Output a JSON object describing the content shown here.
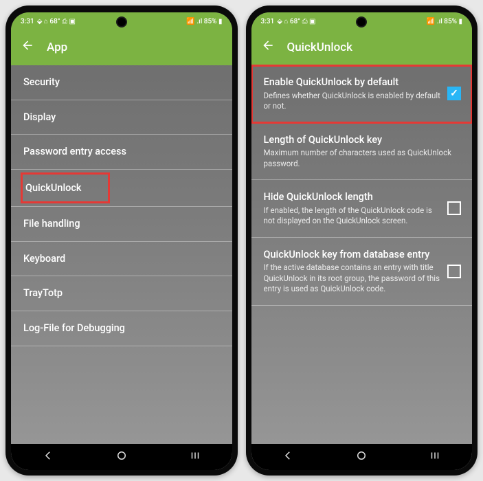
{
  "status": {
    "time": "3:31",
    "indicators": "⬙ ⌂ 68° ⎙ ▣",
    "right": "📶 .ıl 85% ▮"
  },
  "phoneA": {
    "title": "App",
    "items": [
      "Security",
      "Display",
      "Password entry access",
      "QuickUnlock",
      "File handling",
      "Keyboard",
      "TrayTotp",
      "Log-File for Debugging"
    ]
  },
  "phoneB": {
    "title": "QuickUnlock",
    "rows": [
      {
        "title": "Enable QuickUnlock by default",
        "sub": "Defines whether QuickUnlock is enabled by default or not.",
        "checked": true,
        "highlight": true
      },
      {
        "title": "Length of QuickUnlock key",
        "sub": "Maximum number of characters used as QuickUnlock password."
      },
      {
        "title": "Hide QuickUnlock length",
        "sub": "If enabled, the length of the QuickUnlock code is not displayed on the QuickUnlock screen.",
        "checked": false
      },
      {
        "title": "QuickUnlock key from database entry",
        "sub": "If the active database contains an entry with title QuickUnlock in its root group, the password of this entry is used as QuickUnlock code.",
        "checked": false
      }
    ]
  },
  "colors": {
    "accent": "#7cb342",
    "highlight": "#e53935",
    "check": "#29b6f6"
  }
}
